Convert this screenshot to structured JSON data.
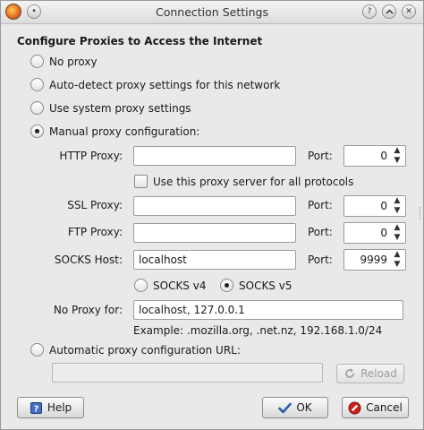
{
  "window": {
    "title": "Connection Settings",
    "controls": [
      "window-menu",
      "help",
      "minimize",
      "maximize",
      "close"
    ]
  },
  "heading": "Configure Proxies to Access the Internet",
  "proxy_modes": [
    {
      "label": "No proxy",
      "checked": false
    },
    {
      "label": "Auto-detect proxy settings for this network",
      "checked": false
    },
    {
      "label": "Use system proxy settings",
      "checked": false
    },
    {
      "label": "Manual proxy configuration:",
      "checked": true
    }
  ],
  "manual": {
    "http": {
      "label": "HTTP Proxy:",
      "value": "",
      "port_label": "Port:",
      "port": "0"
    },
    "use_for_all": {
      "label": "Use this proxy server for all protocols",
      "checked": false
    },
    "ssl": {
      "label": "SSL Proxy:",
      "value": "",
      "port_label": "Port:",
      "port": "0"
    },
    "ftp": {
      "label": "FTP Proxy:",
      "value": "",
      "port_label": "Port:",
      "port": "0"
    },
    "socks": {
      "label": "SOCKS Host:",
      "value": "localhost",
      "port_label": "Port:",
      "port": "9999"
    },
    "socks_versions": [
      {
        "label": "SOCKS v4",
        "checked": false
      },
      {
        "label": "SOCKS v5",
        "checked": true
      }
    ],
    "no_proxy": {
      "label": "No Proxy for:",
      "value": "localhost, 127.0.0.1"
    },
    "example": "Example: .mozilla.org, .net.nz, 192.168.1.0/24"
  },
  "auto_config": {
    "label": "Automatic proxy configuration URL:",
    "checked": false,
    "url": "",
    "reload_label": "Reload"
  },
  "buttons": {
    "help": "Help",
    "ok": "OK",
    "cancel": "Cancel"
  },
  "icons": {
    "app": "firefox-icon",
    "ok": "checkmark-icon",
    "cancel": "cancel-icon",
    "help": "help-book-icon",
    "reload": "reload-icon"
  },
  "colors": {
    "window_bg": "#e9e9e9",
    "ok_check": "#2a5db0",
    "cancel_red": "#c8201e"
  }
}
